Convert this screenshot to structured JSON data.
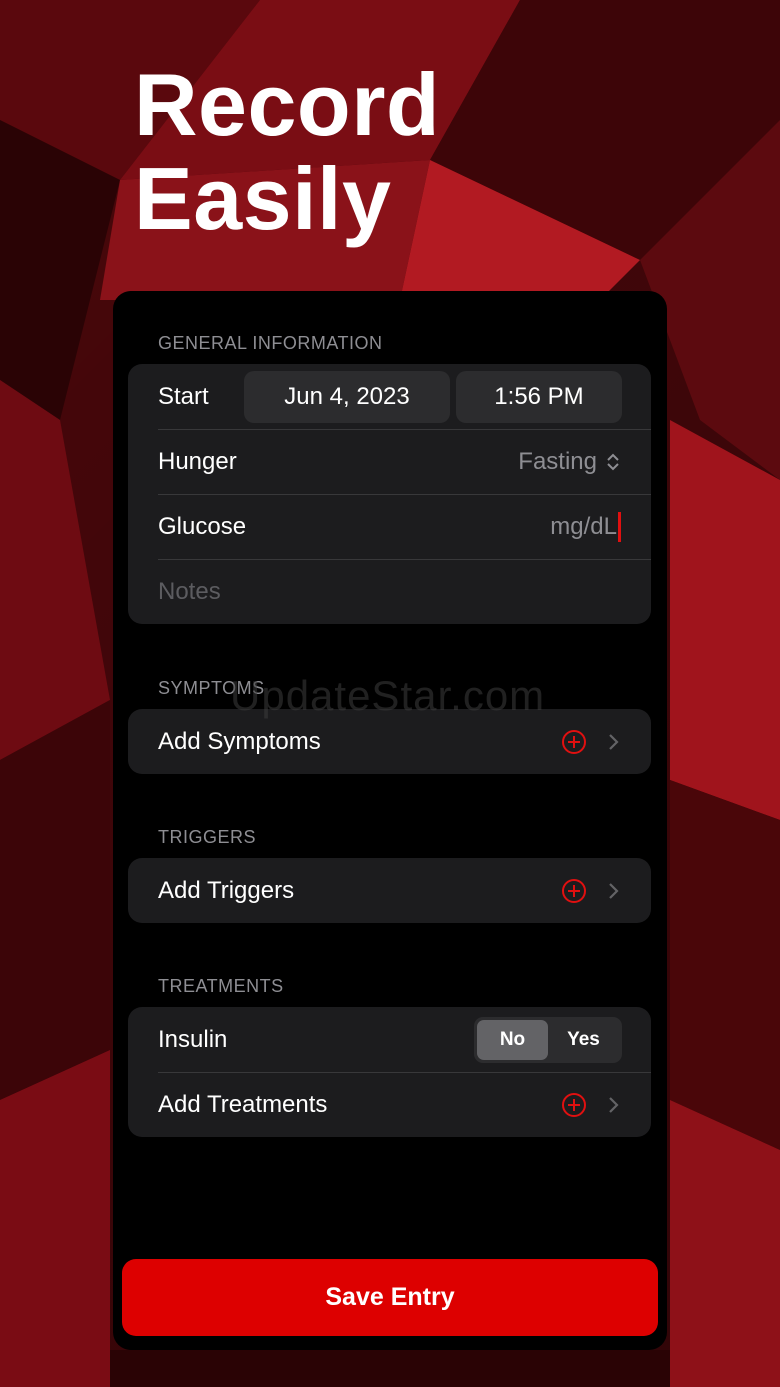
{
  "headline": {
    "line1": "Record",
    "line2": "Easily"
  },
  "sections": {
    "general": {
      "header": "GENERAL INFORMATION",
      "start_label": "Start",
      "start_date": "Jun 4, 2023",
      "start_time": "1:56 PM",
      "hunger_label": "Hunger",
      "hunger_value": "Fasting",
      "glucose_label": "Glucose",
      "glucose_placeholder": "mg/dL",
      "notes_placeholder": "Notes"
    },
    "symptoms": {
      "header": "SYMPTOMS",
      "add_label": "Add Symptoms"
    },
    "triggers": {
      "header": "TRIGGERS",
      "add_label": "Add Triggers"
    },
    "treatments": {
      "header": "TREATMENTS",
      "insulin_label": "Insulin",
      "insulin_options": [
        "No",
        "Yes"
      ],
      "insulin_selected": "No",
      "add_label": "Add Treatments"
    }
  },
  "save_button": "Save Entry",
  "watermark": "UpdateStar.com",
  "colors": {
    "accent": "#dd0000",
    "background": "#000000",
    "card": "#1c1c1e"
  },
  "icons": {
    "add": "plus-circle-icon",
    "disclosure": "chevron-right-icon",
    "picker": "chevron-up-down-icon"
  }
}
